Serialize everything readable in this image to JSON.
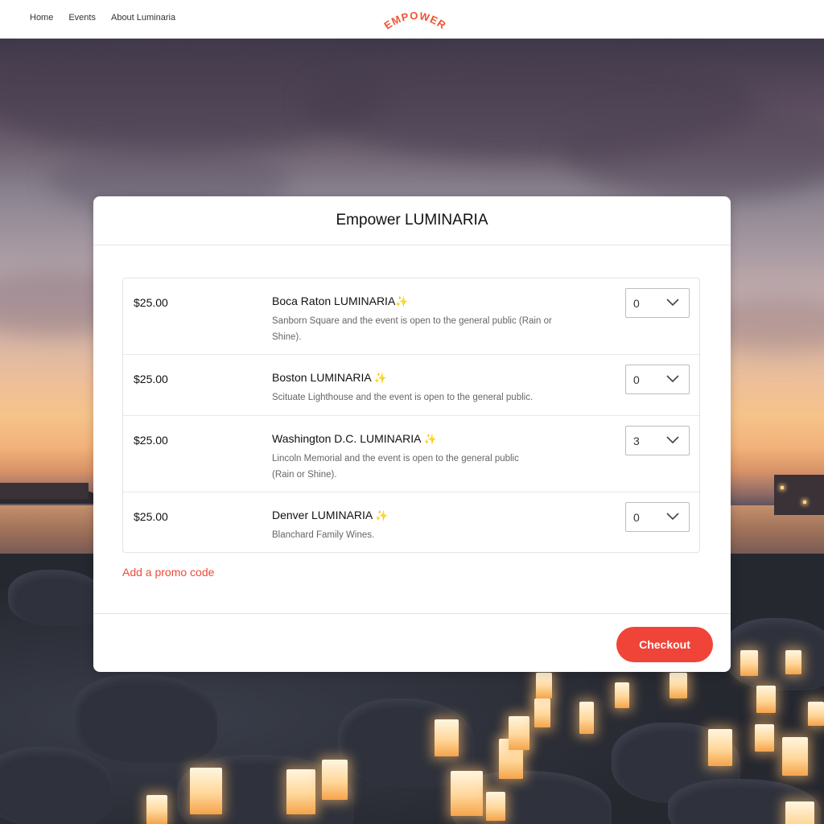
{
  "nav": {
    "links": [
      "Home",
      "Events",
      "About Luminaria"
    ],
    "logo_text": "EMPOWER"
  },
  "card": {
    "title": "Empower LUMINARIA",
    "tickets": [
      {
        "price": "$25.00",
        "name": "Boca Raton LUMINARIA",
        "sparkle": "✨",
        "description": "Sanborn Square and the event is open to the general public (Rain or Shine).",
        "quantity": "0"
      },
      {
        "price": "$25.00",
        "name": "Boston LUMINARIA",
        "sparkle": "✨",
        "description": "Scituate Lighthouse and the event is open to the general public.",
        "quantity": "0"
      },
      {
        "price": "$25.00",
        "name": "Washington D.C. LUMINARIA",
        "sparkle": "✨",
        "description": "Lincoln Memorial and the event is open to the general public (Rain or Shine).",
        "quantity": "3"
      },
      {
        "price": "$25.00",
        "name": "Denver LUMINARIA",
        "sparkle": "✨",
        "description": "Blanchard Family Wines.",
        "quantity": "0"
      }
    ],
    "promo_link": "Add a promo code",
    "checkout_label": "Checkout"
  },
  "colors": {
    "accent": "#f04438",
    "logo": "#f0532f"
  }
}
